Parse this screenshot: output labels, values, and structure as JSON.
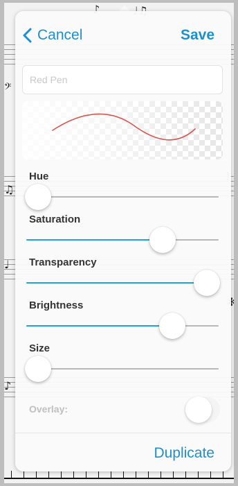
{
  "nav": {
    "cancel_label": "Cancel",
    "save_label": "Save"
  },
  "pen_name": {
    "value": "",
    "placeholder": "Red Pen"
  },
  "preview": {
    "stroke_color": "#d9544f"
  },
  "sliders": [
    {
      "label": "Hue",
      "value": 0.06
    },
    {
      "label": "Saturation",
      "value": 0.71
    },
    {
      "label": "Transparency",
      "value": 0.94
    },
    {
      "label": "Brightness",
      "value": 0.76
    },
    {
      "label": "Size",
      "value": 0.06
    }
  ],
  "overlay": {
    "label": "Overlay:",
    "enabled": false
  },
  "footer": {
    "duplicate_label": "Duplicate"
  },
  "colors": {
    "accent": "#1d8fd0",
    "slider_fill": "#1fa3dc"
  }
}
